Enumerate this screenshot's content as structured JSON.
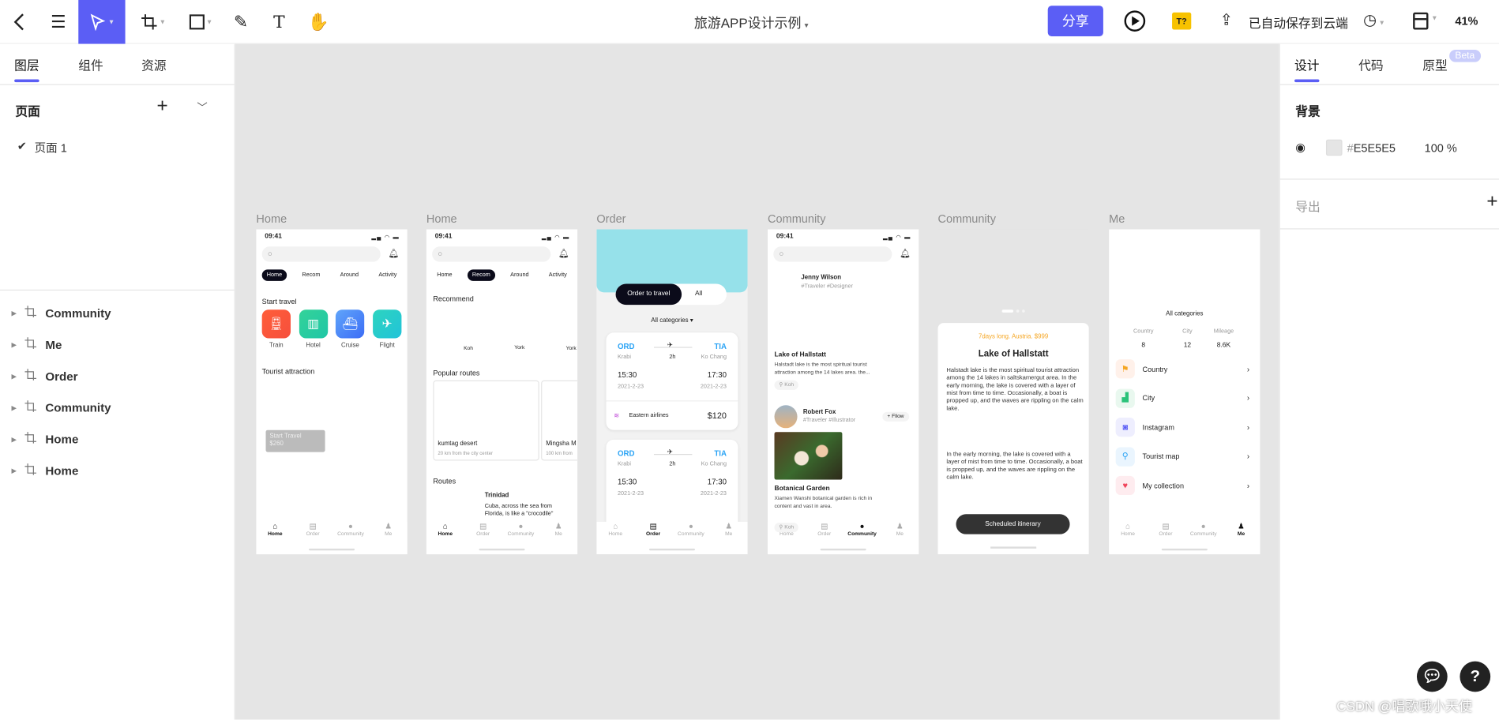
{
  "toolbar": {
    "title": "旅游APP设计示例",
    "share": "分享",
    "badge": "T?",
    "autosave": "已自动保存到云端",
    "zoom": "41%",
    "accent": "#5b5ef5",
    "icons": [
      "back-icon",
      "menu-icon",
      "select-pointer-icon",
      "frame-crop-icon",
      "rectangle-icon",
      "pen-icon",
      "text-icon",
      "hand-icon",
      "play-icon",
      "cloud-upload-icon",
      "history-icon",
      "layout-icon"
    ]
  },
  "left": {
    "tabs": [
      "图层",
      "组件",
      "资源"
    ],
    "pages_title": "页面",
    "page": "页面 1",
    "layers": [
      "Community",
      "Me",
      "Order",
      "Community",
      "Home",
      "Home"
    ]
  },
  "right": {
    "tabs": [
      "设计",
      "代码",
      "原型"
    ],
    "beta": "Beta",
    "bg_title": "背景",
    "hash": "#",
    "bg_color": "E5E5E5",
    "opacity": "100 %",
    "export": "导出"
  },
  "canvas": {
    "background": "#E5E5E5",
    "frames": [
      "Home",
      "Home",
      "Order",
      "Community",
      "Community",
      "Me"
    ]
  },
  "phone": {
    "time": "09:41",
    "tabs": [
      "Home",
      "Recom",
      "Around",
      "Activity"
    ],
    "nav": [
      "Home",
      "Order",
      "Community",
      "Me"
    ]
  },
  "home": {
    "start_travel": "Start travel",
    "services": [
      "Train",
      "Hotel",
      "Cruise",
      "Flight"
    ],
    "tourist": "Tourist attraction",
    "promo_1": "Start Travel",
    "promo_2": "$260"
  },
  "recom": {
    "recommend": "Recommend",
    "places": [
      "Koh",
      "York",
      "York"
    ],
    "popular": "Popular routes",
    "routes_cards": [
      {
        "name": "kumtag desert",
        "sub": "20 km from the city center"
      },
      {
        "name": "Mingsha M",
        "sub": "100 km from"
      }
    ],
    "routes": "Routes",
    "route_name": "Trinidad",
    "route_desc_1": "Cuba, across the sea from",
    "route_desc_2": "Florida, is like a \"crocodile\""
  },
  "order": {
    "toggle_on": "Order to travel",
    "toggle_off": "All",
    "categories": "All categories ▾",
    "ticket": {
      "from": "ORD",
      "to": "TIA",
      "from_city": "Krabi",
      "to_city": "Ko Chang",
      "duration": "2h",
      "dep": "15:30",
      "arr": "17:30",
      "date": "2021-2-23",
      "airline": "Eastern airlines",
      "price": "$120"
    }
  },
  "community": {
    "user1": "Jenny Wilson",
    "user1_tags": "#Traveler  #Designer",
    "post1_title": "Lake of Hallstatt",
    "post1_1": "Halstadt lake is the most spiritual tourist",
    "post1_2": "attraction among the 14 lakes  area. the...",
    "tag": "Koh",
    "user2": "Robert Fox",
    "user2_tags": "#Traveler #Illustrator",
    "follow": "+ Fllow",
    "post2_title": "Botanical Garden",
    "post2_1": "Xiamen Wanshi botanical garden is rich in",
    "post2_2": "content and vast in area."
  },
  "detail": {
    "meta": "7days long. Austria. $999",
    "title": "Lake of Hallstatt",
    "p1": "Halstadt lake is the most spiritual tourist attraction among the 14 lakes in saltskamergut area. In the early morning, the lake is covered with a layer of mist from time to time. Occasionally, a boat is propped up, and the waves are rippling on the calm lake.",
    "p2": "In the early morning, the lake is covered with a layer of mist from time to time. Occasionally, a boat is propped up, and the waves are rippling on the calm lake.",
    "button": "Scheduled itinerary",
    "meta_color": "#f5a623"
  },
  "me": {
    "title": "All categories",
    "stats": [
      {
        "label": "Country",
        "value": "8"
      },
      {
        "label": "City",
        "value": "12"
      },
      {
        "label": "Mileage",
        "value": "8.6K"
      }
    ],
    "items": [
      "Country",
      "City",
      "Instagram",
      "Tourist map",
      "My collection"
    ]
  },
  "watermark": "CSDN @唱歌哦小天使"
}
